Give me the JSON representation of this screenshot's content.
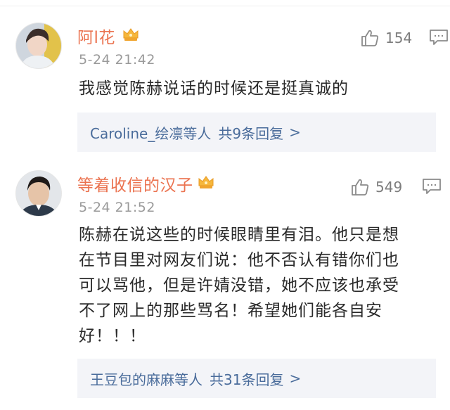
{
  "comments": [
    {
      "username": "阿l花",
      "timestamp": "5-24 21:42",
      "like_count": "154",
      "text": "我感觉陈赫说话的时候还是挺真诚的",
      "reply_preview": {
        "names": "Caroline_绘凛",
        "suffix": "等人",
        "count": "共9条回复",
        "chevron": ">"
      }
    },
    {
      "username": "等着收信的汉子",
      "timestamp": "5-24 21:52",
      "like_count": "549",
      "text": "陈赫在说这些的时候眼睛里有泪。他只是想\n在节目里对网友们说：他不否认有错你们也\n可以骂他，但是许婧没错，她不应该也承受\n不了网上的那些骂名！希望她们能各自安\n好！！！",
      "reply_preview": {
        "names": "王豆包的麻麻",
        "suffix": "等人",
        "count": "共31条回复",
        "chevron": ">"
      }
    }
  ],
  "colors": {
    "username": "#eb7350",
    "link": "#4a6c9b",
    "meta": "#9a9a9a",
    "reply_bg": "#f3f4f8"
  },
  "icons": [
    "avatar",
    "vip-crown-icon",
    "thumbs-up-icon",
    "reply-comment-icon"
  ]
}
